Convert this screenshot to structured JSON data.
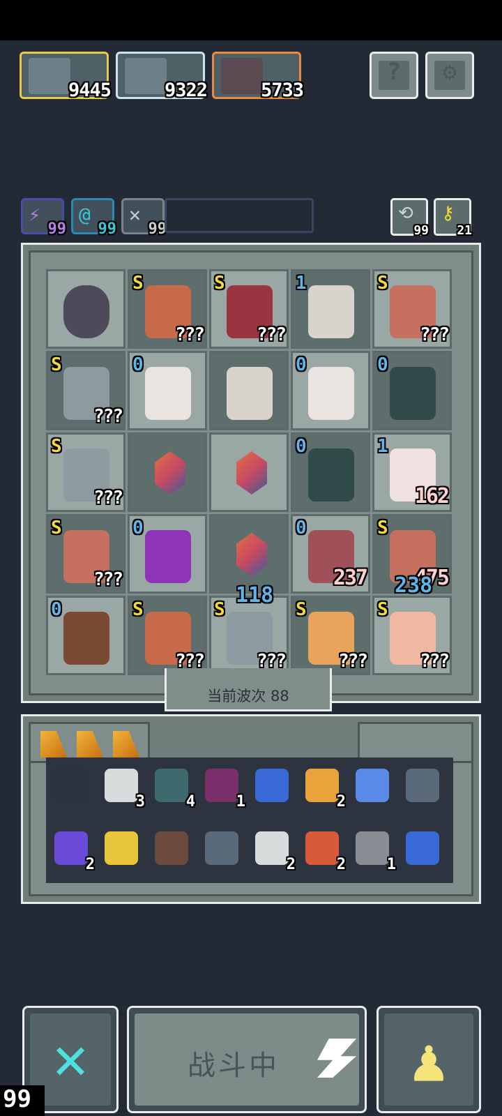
{
  "top": {
    "heroes": [
      {
        "score": "9445",
        "border": "#e8c84a"
      },
      {
        "score": "9322",
        "border": "#cfe3ea"
      },
      {
        "score": "5733",
        "border": "#e58b43"
      }
    ],
    "help_glyph": "?",
    "settings_glyph": "⚙"
  },
  "resources": [
    {
      "icon": "lightning-icon",
      "glyph": "⚡",
      "value": "99",
      "color": "#b57ee8"
    },
    {
      "icon": "swirl-icon",
      "glyph": "@",
      "value": "99",
      "color": "#39c7d8"
    },
    {
      "icon": "wing-icon",
      "glyph": "✕",
      "value": "99",
      "color": "#c7cccc"
    }
  ],
  "side_counters": [
    {
      "icon": "refresh-icon",
      "glyph": "⟲",
      "value": "99"
    },
    {
      "icon": "key-icon",
      "glyph": "⚷",
      "value": "21"
    }
  ],
  "board": {
    "rows": [
      [
        {
          "kind": "rock"
        },
        {
          "rank": "S",
          "label": "???",
          "c": "#c76a4a"
        },
        {
          "rank": "S",
          "label": "???",
          "c": "#9a3440"
        },
        {
          "rank": "1",
          "label": "",
          "c": "#d8d4cc"
        },
        {
          "rank": "S",
          "label": "???",
          "c": "#c67060"
        }
      ],
      [
        {
          "rank": "S",
          "label": "???",
          "c": "#8d9aa0"
        },
        {
          "rank": "0",
          "label": "",
          "c": "#e9e4e0"
        },
        {
          "kind": "skeleton"
        },
        {
          "rank": "0",
          "label": "",
          "c": "#e9e4e0"
        },
        {
          "rank": "0",
          "label": "",
          "c": "#2f4a48"
        }
      ],
      [
        {
          "rank": "S",
          "label": "???",
          "c": "#8d9aa0"
        },
        {
          "kind": "gem"
        },
        {
          "kind": "gem"
        },
        {
          "rank": "0",
          "label": "",
          "c": "#2f4a48"
        },
        {
          "rank": "1",
          "label": "162",
          "c": "#f0e0e0"
        }
      ],
      [
        {
          "rank": "S",
          "label": "???",
          "c": "#c67060"
        },
        {
          "rank": "0",
          "label": "",
          "c": "#8e34b8"
        },
        {
          "kind": "gem"
        },
        {
          "rank": "0",
          "label": "237",
          "c": "#a05058"
        },
        {
          "rank": "S",
          "label": "475",
          "c": "#c67060"
        }
      ],
      [
        {
          "rank": "0",
          "label": "",
          "c": "#7a4a34"
        },
        {
          "rank": "S",
          "label": "???",
          "c": "#c76a4a"
        },
        {
          "rank": "S",
          "label": "???",
          "c": "#8d9aa0"
        },
        {
          "rank": "S",
          "label": "???",
          "c": "#e8a45a"
        },
        {
          "rank": "S",
          "label": "???",
          "c": "#f0b8a0"
        }
      ]
    ],
    "floating": {
      "a": "118",
      "b": "238"
    }
  },
  "wave_label": "当前波次 88",
  "inventory": {
    "items": [
      {
        "icon": "crate-icon",
        "count": "",
        "c": "#2a3440"
      },
      {
        "icon": "scroll-icon",
        "count": "3",
        "c": "#d8dcdc"
      },
      {
        "icon": "heart-shield-icon",
        "count": "4",
        "c": "#3e6a6e"
      },
      {
        "icon": "demon-mask-icon",
        "count": "1",
        "c": "#7a2e6a"
      },
      {
        "icon": "blue-flame-icon",
        "count": "",
        "c": "#3a6ad8"
      },
      {
        "icon": "spark-icon",
        "count": "2",
        "c": "#e8a43a"
      },
      {
        "icon": "blue-feather-icon",
        "count": "",
        "c": "#5a8ae8"
      },
      {
        "icon": "hammer-icon",
        "count": "",
        "c": "#5a6a7a"
      },
      {
        "icon": "potion-jar-icon",
        "count": "2",
        "c": "#6a4ad8"
      },
      {
        "icon": "golden-chalice-icon",
        "count": "",
        "c": "#e8c83a"
      },
      {
        "icon": "grass-patch-icon",
        "count": "",
        "c": "#6a4a3a"
      },
      {
        "icon": "shuriken-icon",
        "count": "",
        "c": "#5a6a7a"
      },
      {
        "icon": "bone-claw-icon",
        "count": "2",
        "c": "#d8dcdc"
      },
      {
        "icon": "fire-banner-icon",
        "count": "2",
        "c": "#d85a3a"
      },
      {
        "icon": "skull-boot-icon",
        "count": "1",
        "c": "#8a8e94"
      },
      {
        "icon": "water-drop-icon",
        "count": "",
        "c": "#3a6ad8"
      }
    ]
  },
  "bottom": {
    "cancel_glyph": "✕",
    "fight_label": "战斗中",
    "pawn_glyph": "♟",
    "counter": "99"
  }
}
